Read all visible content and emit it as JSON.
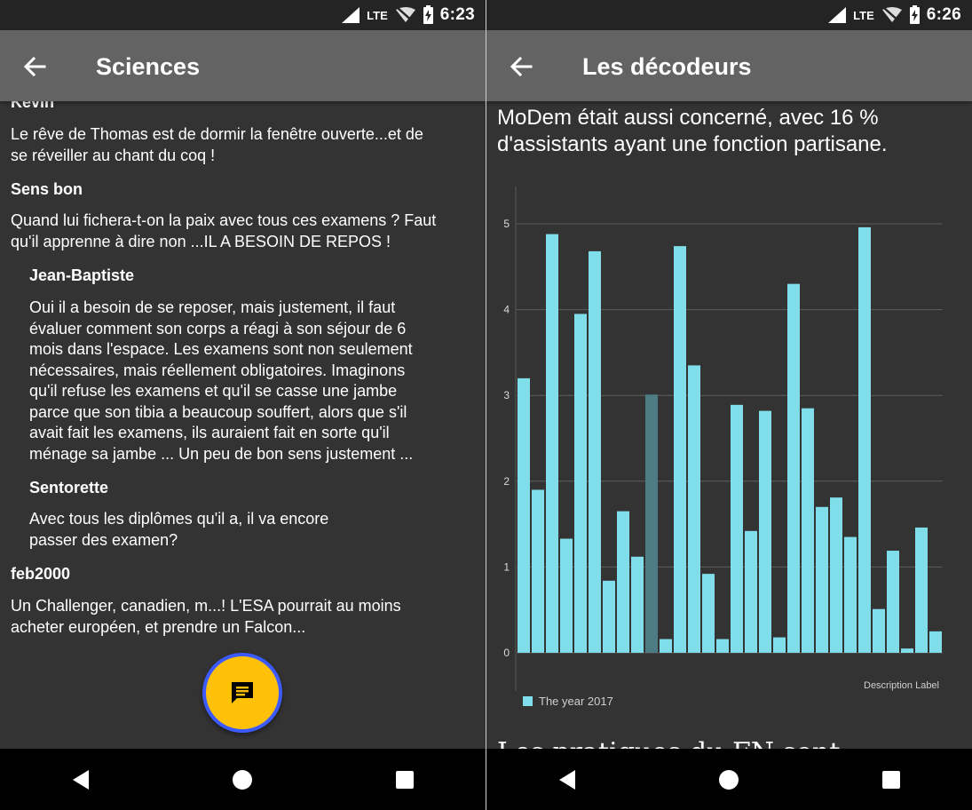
{
  "left": {
    "status": {
      "network": "LTE",
      "time": "6:23"
    },
    "toolbar": {
      "title": "Sciences"
    },
    "comments": [
      {
        "author": "Kevin",
        "text": "Le rêve de Thomas est de dormir la fenêtre ouverte...et de\nse réveiller au chant du coq !",
        "indent": false
      },
      {
        "author": "Sens bon",
        "text": "Quand lui fichera-t-on la paix avec tous ces examens ? Faut\nqu'il apprenne à dire non ...IL A BESOIN DE REPOS !",
        "indent": false
      },
      {
        "author": "Jean-Baptiste",
        "text": "Oui il a besoin de se reposer, mais justement, il faut\névaluer comment son corps a réagi à son séjour de 6\nmois dans l'espace. Les examens sont non seulement\nnécessaires, mais réellement obligatoires. Imaginons\nqu'il refuse les examens et qu'il se casse une jambe\nparce que son tibia a beaucoup souffert, alors que s'il\navait fait les examens, ils auraient fait en sorte qu'il\nménage sa jambe ... Un peu de bon sens justement ...",
        "indent": true
      },
      {
        "author": "Sentorette",
        "text": "Avec tous les diplômes qu'il a, il va encore\npasser des examen?",
        "indent": true
      },
      {
        "author": "feb2000",
        "text": "Un Challenger, canadien, m...! L'ESA pourrait au moins\nacheter européen, et prendre un Falcon...",
        "indent": false
      }
    ],
    "fab_icon": "comment-icon"
  },
  "right": {
    "status": {
      "network": "LTE",
      "time": "6:26"
    },
    "toolbar": {
      "title": "Les décodeurs"
    },
    "article_text": "MoDem était aussi concerné, avec 16 %\nd'assistants ayant une fonction partisane.",
    "article_next_heading": "Les pratiques du FN sont"
  },
  "colors": {
    "bar": "#80deea",
    "bar_highlight": "#4e7c85",
    "toolbar": "#636363",
    "background": "#333333",
    "fab": "#ffc107",
    "fab_ring": "#3d5afe"
  },
  "chart_data": {
    "type": "bar",
    "series": [
      {
        "name": "The year 2017",
        "values": [
          3.2,
          1.9,
          4.88,
          1.33,
          3.95,
          4.68,
          0.84,
          1.65,
          1.12,
          3.01,
          0.16,
          4.74,
          3.35,
          0.92,
          0.16,
          2.89,
          1.42,
          2.82,
          0.18,
          4.3,
          2.85,
          1.7,
          1.81,
          1.35,
          4.96,
          0.51,
          1.19,
          0.05,
          1.46,
          0.25
        ]
      }
    ],
    "highlighted_index": 9,
    "yticks": [
      0,
      1,
      2,
      3,
      4,
      5
    ],
    "ylim": [
      0,
      5
    ],
    "description": "Description Label",
    "legend_position": "bottom-left",
    "grid": true
  }
}
